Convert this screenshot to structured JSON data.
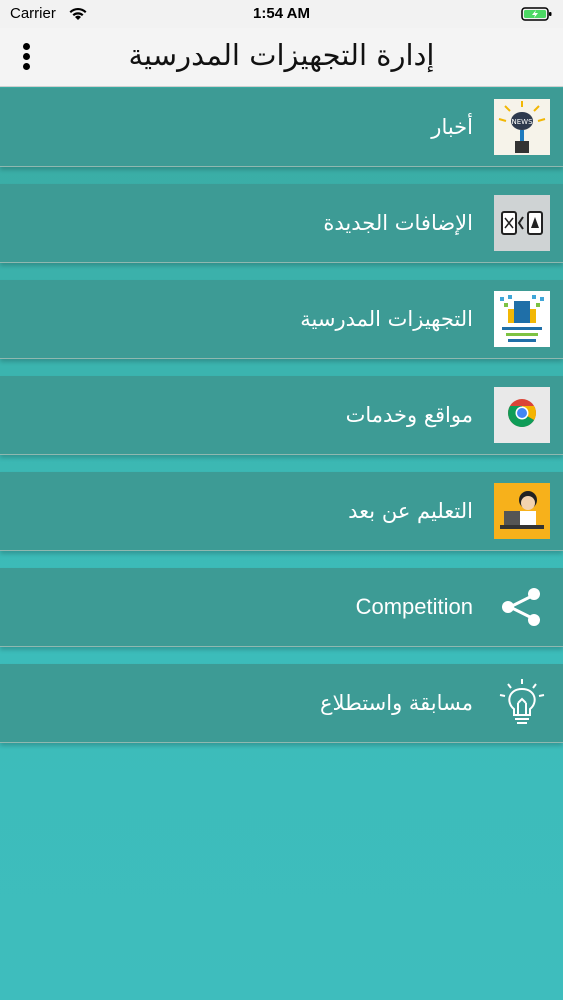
{
  "status": {
    "carrier": "Carrier",
    "time": "1:54 AM"
  },
  "header": {
    "title": "إدارة التجهيزات المدرسية"
  },
  "menu": [
    {
      "label": "أخبار",
      "icon": "news-icon"
    },
    {
      "label": "الإضافات الجديدة",
      "icon": "arrow-swap-icon"
    },
    {
      "label": "التجهيزات المدرسية",
      "icon": "school-logo-icon"
    },
    {
      "label": "مواقع وخدمات",
      "icon": "chrome-icon"
    },
    {
      "label": "التعليم عن بعد",
      "icon": "remote-learning-icon"
    },
    {
      "label": "Competition",
      "icon": "share-icon"
    },
    {
      "label": "مسابقة واستطلاع",
      "icon": "lightbulb-icon"
    }
  ],
  "colors": {
    "row": "#3d9b95",
    "background": "#3ebdbd",
    "header": "#f4f4f4"
  }
}
